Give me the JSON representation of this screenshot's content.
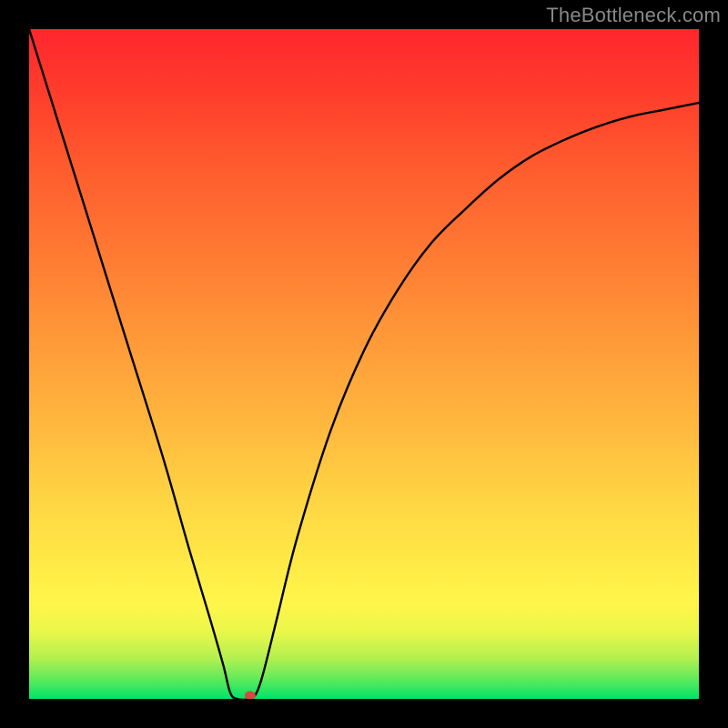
{
  "watermark": "TheBottleneck.com",
  "chart_data": {
    "type": "line",
    "title": "",
    "xlabel": "",
    "ylabel": "",
    "xlim": [
      0,
      100
    ],
    "ylim": [
      0,
      100
    ],
    "grid": false,
    "legend": false,
    "series": [
      {
        "name": "curve",
        "x": [
          0,
          5,
          10,
          15,
          20,
          24,
          27,
          29,
          30,
          31,
          33,
          34,
          35,
          37,
          40,
          45,
          50,
          55,
          60,
          65,
          70,
          75,
          80,
          85,
          90,
          95,
          100
        ],
        "y": [
          100,
          84,
          68,
          52,
          36,
          22,
          12,
          5,
          1,
          0,
          0,
          1,
          4,
          12,
          24,
          40,
          52,
          61,
          68,
          73,
          77.5,
          81,
          83.5,
          85.5,
          87,
          88,
          89
        ]
      }
    ],
    "marker": {
      "x": 33,
      "y": 0.5,
      "color": "#d24a3f"
    },
    "background_gradient": {
      "stops": [
        {
          "pos": 0,
          "color": "#00e46a"
        },
        {
          "pos": 3,
          "color": "#61ea5a"
        },
        {
          "pos": 6,
          "color": "#b2f050"
        },
        {
          "pos": 10,
          "color": "#e9f74a"
        },
        {
          "pos": 14,
          "color": "#fff64a"
        },
        {
          "pos": 20,
          "color": "#ffea47"
        },
        {
          "pos": 30,
          "color": "#ffd443"
        },
        {
          "pos": 42,
          "color": "#ffb53e"
        },
        {
          "pos": 55,
          "color": "#ff9638"
        },
        {
          "pos": 68,
          "color": "#ff7632"
        },
        {
          "pos": 80,
          "color": "#ff5a2e"
        },
        {
          "pos": 90,
          "color": "#ff3e2c"
        },
        {
          "pos": 100,
          "color": "#ff262d"
        }
      ]
    }
  }
}
